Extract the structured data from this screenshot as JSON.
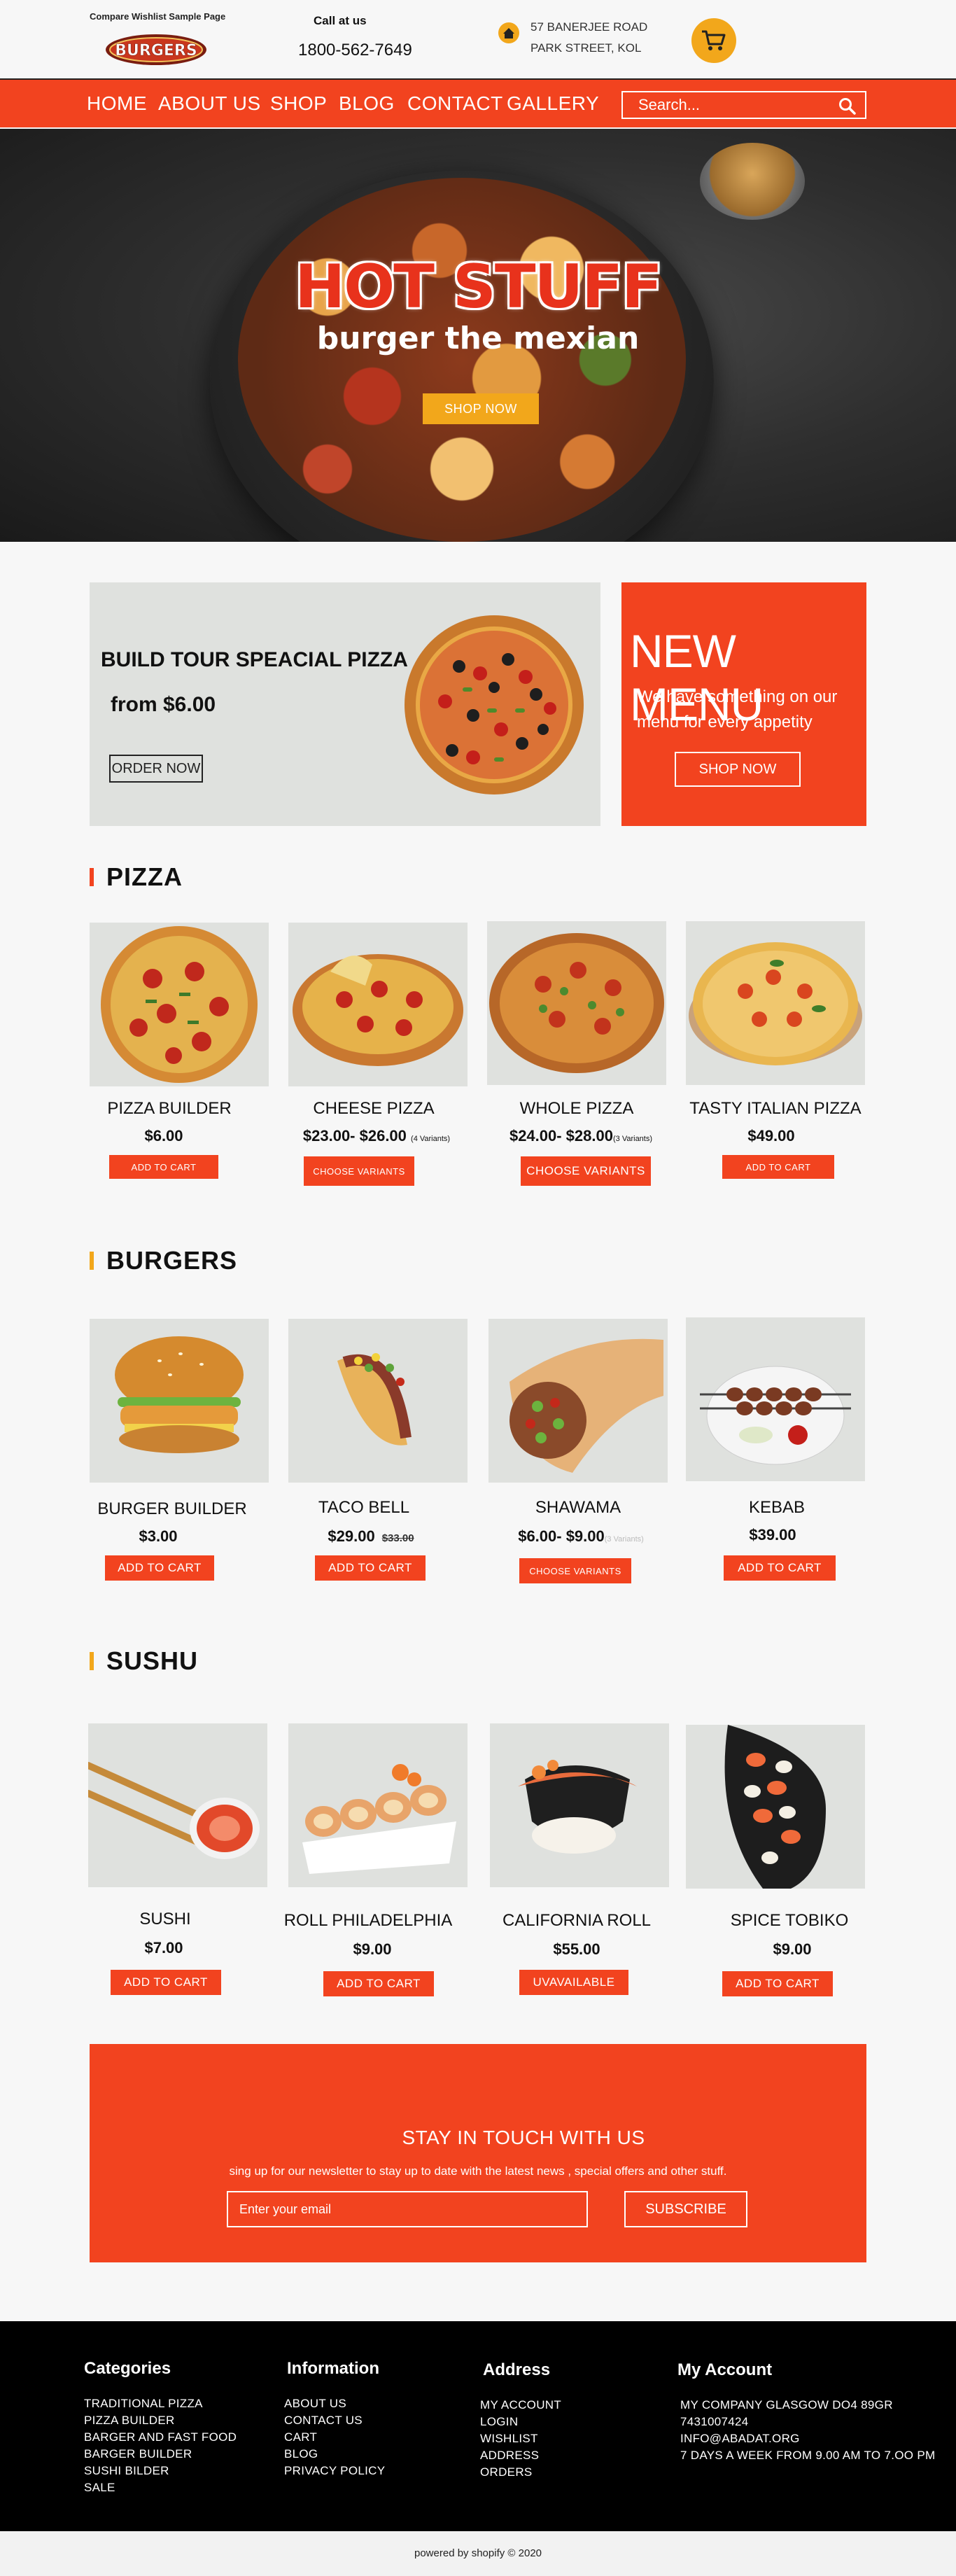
{
  "header": {
    "top_links": "Compare Wishlist Sample Page",
    "logo_text": "BURGERS",
    "call_label": "Call at us",
    "phone": "1800-562-7649",
    "address_line1": "57 BANERJEE ROAD",
    "address_line2": "PARK STREET, KOL",
    "brand_color": "#f2431f",
    "accent_color": "#f2a71b"
  },
  "nav": {
    "items": [
      "HOME",
      "ABOUT US",
      "SHOP",
      "BLOG",
      "CONTACT",
      "GALLERY"
    ],
    "search_placeholder": "Search..."
  },
  "hero": {
    "title": "HOT STUFF",
    "subtitle": "burger the mexian",
    "button": "SHOP NOW"
  },
  "promo": {
    "title": "BUILD TOUR SPEACIAL PIZZA",
    "price": "from $6.00",
    "button": "ORDER NOW",
    "new_menu_title": "NEW MENU",
    "new_menu_text": "We have something on our menu for every appetity",
    "new_menu_button": "SHOP NOW"
  },
  "pizza": {
    "title": "PIZZA",
    "products": [
      {
        "name": "PIZZA BUILDER",
        "price": "$6.00",
        "variants": "",
        "old_price": "",
        "button": "ADD TO CART"
      },
      {
        "name": "CHEESE PIZZA",
        "price": "$23.00- $26.00",
        "variants": "(4 Variants)",
        "old_price": "",
        "button": "CHOOSE VARIANTS"
      },
      {
        "name": "WHOLE PIZZA",
        "price": "$24.00- $28.00",
        "variants": "(3 Variants)",
        "old_price": "",
        "button": "CHOOSE VARIANTS"
      },
      {
        "name": "TASTY ITALIAN PIZZA",
        "price": "$49.00",
        "variants": "",
        "old_price": "",
        "button": "ADD TO CART"
      }
    ]
  },
  "burgers": {
    "title": "BURGERS",
    "products": [
      {
        "name": "BURGER BUILDER",
        "price": "$3.00",
        "variants": "",
        "old_price": "",
        "button": "ADD TO CART"
      },
      {
        "name": "TACO BELL",
        "price": "$29.00",
        "variants": "",
        "old_price": "$33.00",
        "button": "ADD TO CART"
      },
      {
        "name": "SHAWAMA",
        "price": "$6.00- $9.00",
        "variants": "(3 Variants)",
        "old_price": "",
        "button": "CHOOSE VARIANTS"
      },
      {
        "name": "KEBAB",
        "price": "$39.00",
        "variants": "",
        "old_price": "",
        "button": "ADD TO CART"
      }
    ]
  },
  "sushi": {
    "title": "SUSHU",
    "products": [
      {
        "name": "SUSHI",
        "price": "$7.00",
        "variants": "",
        "old_price": "",
        "button": "ADD TO CART"
      },
      {
        "name": "ROLL PHILADELPHIA",
        "price": "$9.00",
        "variants": "",
        "old_price": "",
        "button": "ADD TO CART"
      },
      {
        "name": "CALIFORNIA ROLL",
        "price": "$55.00",
        "variants": "",
        "old_price": "",
        "button": "UVAVAILABLE"
      },
      {
        "name": "SPICE TOBIKO",
        "price": "$9.00",
        "variants": "",
        "old_price": "",
        "button": "ADD TO CART"
      }
    ]
  },
  "newsletter": {
    "title": "STAY IN TOUCH WITH US",
    "text": "sing up for our newsletter to stay up to date with the latest news , special offers and other stuff.",
    "placeholder": "Enter your email",
    "button": "SUBSCRIBE"
  },
  "footer": {
    "categories": {
      "title": "Categories",
      "items": [
        "TRADITIONAL PIZZA",
        "PIZZA BUILDER",
        "BARGER AND FAST FOOD",
        "BARGER BUILDER",
        "SUSHI BILDER",
        "SALE"
      ]
    },
    "information": {
      "title": "Information",
      "items": [
        "ABOUT US",
        "CONTACT US",
        "CART",
        "BLOG",
        "PRIVACY POLICY"
      ]
    },
    "address": {
      "title": "Address",
      "items": [
        "MY ACCOUNT",
        "LOGIN",
        "WISHLIST",
        "ADDRESS",
        "ORDERS"
      ]
    },
    "account": {
      "title": "My Account",
      "items": [
        "MY COMPANY GLASGOW DO4 89GR",
        "7431007424",
        "INFO@ABADAT.ORG",
        "7 DAYS A WEEK FROM 9.00 AM TO 7.OO PM"
      ]
    },
    "copyright": "powered by shopify  © 2020"
  }
}
